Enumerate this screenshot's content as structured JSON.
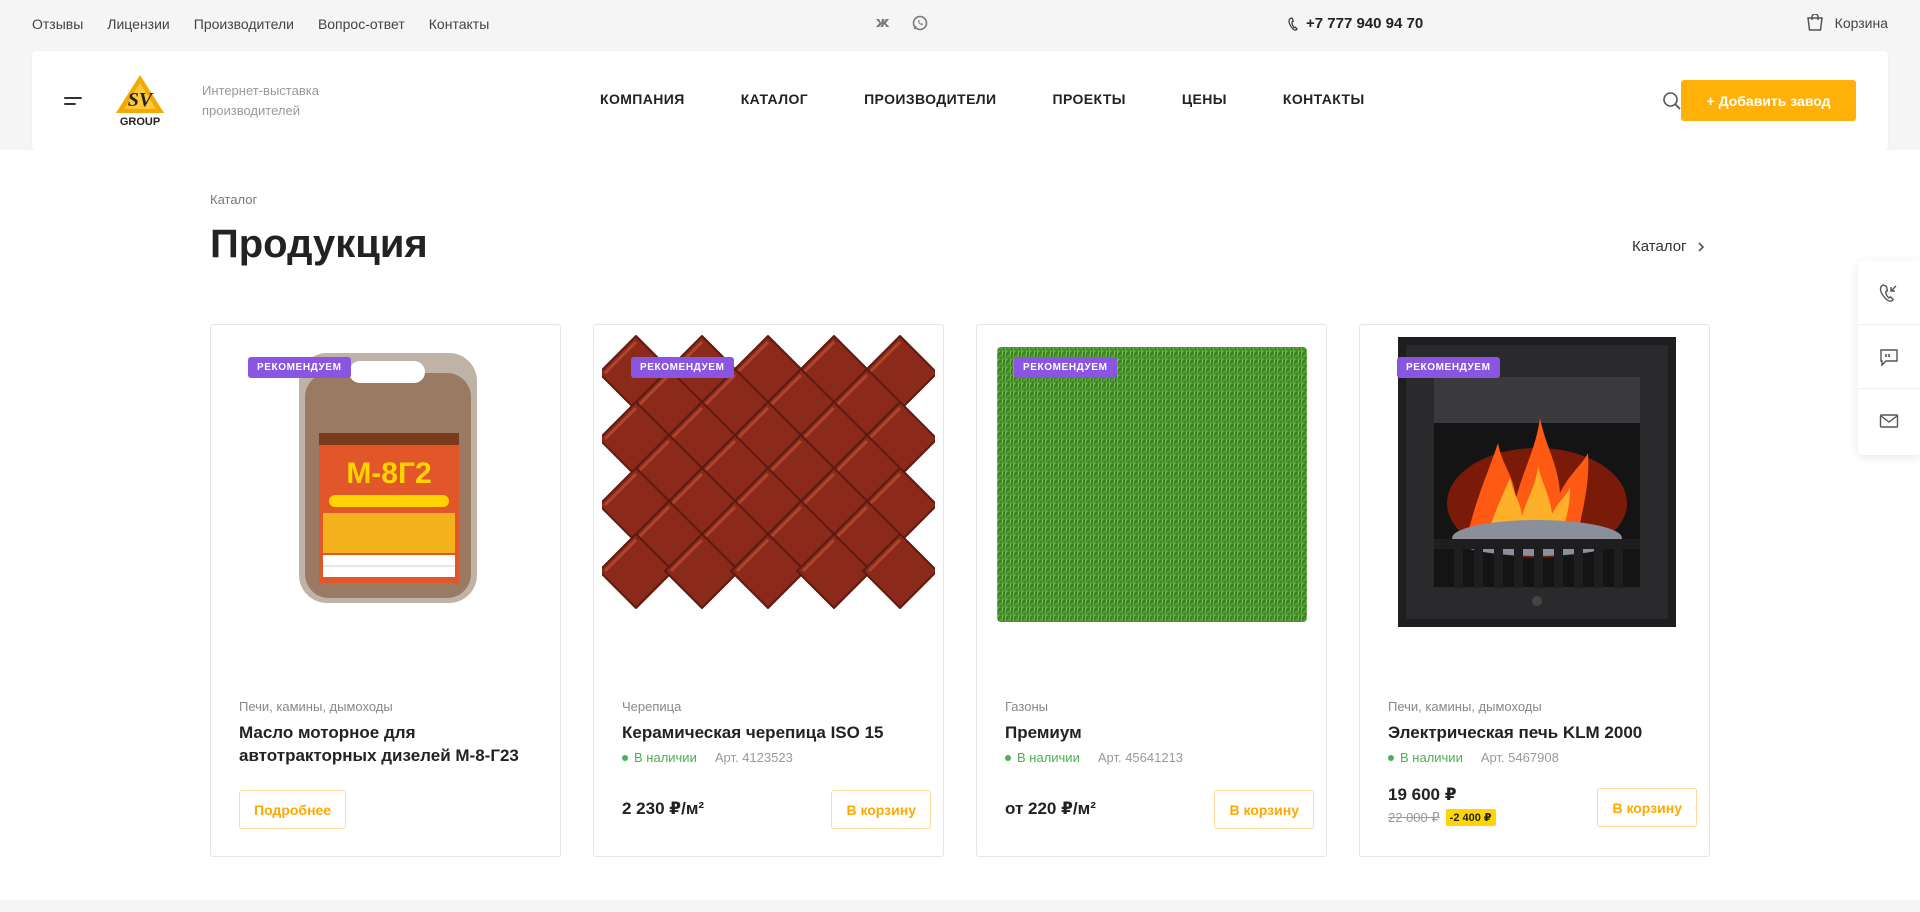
{
  "topbar": {
    "links": [
      "Отзывы",
      "Лицензии",
      "Производители",
      "Вопрос-ответ",
      "Контакты"
    ],
    "phone": "+7 777 940 94 70",
    "cart_label": "Корзина",
    "socials": [
      "vk-icon",
      "whatsapp-icon"
    ]
  },
  "header": {
    "logo_text": "SV",
    "logo_sub": "GROUP",
    "tagline": "Интернет-выставка производителей",
    "nav": [
      "КОМПАНИЯ",
      "КАТАЛОГ",
      "ПРОИЗВОДИТЕЛИ",
      "ПРОЕКТЫ",
      "ЦЕНЫ",
      "КОНТАКТЫ"
    ],
    "add_button": "+ Добавить завод",
    "accent": "#ffb10a"
  },
  "page": {
    "breadcrumb": "Каталог",
    "title": "Продукция",
    "catalog_link": "Каталог"
  },
  "cards": [
    {
      "badge": "РЕКОМЕНДУЕМ",
      "category": "Печи, камины, дымоходы",
      "name": "Масло моторное для автотракторных дизелей М-8-Г23",
      "button": "Подробнее"
    },
    {
      "badge": "РЕКОМЕНДУЕМ",
      "category": "Черепица",
      "name": "Керамическая черепица ISO 15",
      "stock": "В наличии",
      "art": "Арт. 4123523",
      "price": "2 230 ₽/м²",
      "button": "В корзину"
    },
    {
      "badge": "РЕКОМЕНДУЕМ",
      "category": "Газоны",
      "name": "Премиум",
      "stock": "В наличии",
      "art": "Арт. 45641213",
      "price": "от 220 ₽/м²",
      "button": "В корзину"
    },
    {
      "badge": "РЕКОМЕНДУЕМ",
      "category": "Печи, камины, дымоходы",
      "name": "Электрическая печь KLM 2000",
      "stock": "В наличии",
      "art": "Арт. 5467908",
      "price": "19 600 ₽",
      "old_price": "22 000 ₽",
      "discount": "-2 400 ₽",
      "button": "В корзину"
    }
  ],
  "side_widget": [
    "phone-callback-icon",
    "chat-icon",
    "mail-icon"
  ],
  "colors": {
    "badge": "#8a55e0",
    "stock": "#4caf50",
    "discount": "#ffd400"
  }
}
